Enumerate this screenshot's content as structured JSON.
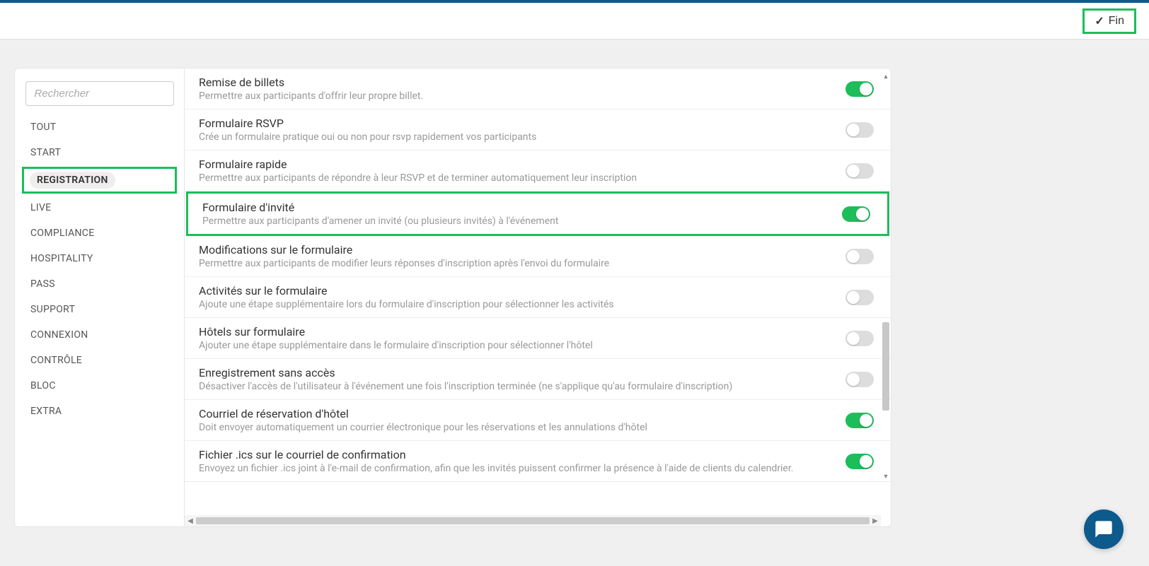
{
  "header": {
    "fin_label": "Fin"
  },
  "sidebar": {
    "search_placeholder": "Rechercher",
    "items": [
      {
        "label": "TOUT"
      },
      {
        "label": "START"
      },
      {
        "label": "REGISTRATION"
      },
      {
        "label": "LIVE"
      },
      {
        "label": "COMPLIANCE"
      },
      {
        "label": "HOSPITALITY"
      },
      {
        "label": "PASS"
      },
      {
        "label": "SUPPORT"
      },
      {
        "label": "CONNEXION"
      },
      {
        "label": "CONTRÔLE"
      },
      {
        "label": "BLOC"
      },
      {
        "label": "EXTRA"
      }
    ]
  },
  "settings": [
    {
      "title": "Remise de billets",
      "desc": "Permettre aux participants d'offrir leur propre billet.",
      "on": true,
      "highlighted": false
    },
    {
      "title": "Formulaire RSVP",
      "desc": "Crée un formulaire pratique oui ou non pour rsvp rapidement vos participants",
      "on": false,
      "highlighted": false
    },
    {
      "title": "Formulaire rapide",
      "desc": "Permettre aux participants de répondre à leur RSVP et de terminer automatiquement leur inscription",
      "on": false,
      "highlighted": false
    },
    {
      "title": "Formulaire d'invité",
      "desc": "Permettre aux participants d'amener un invité (ou plusieurs invités) à l'événement",
      "on": true,
      "highlighted": true
    },
    {
      "title": "Modifications sur le formulaire",
      "desc": "Permettre aux participants de modifier leurs réponses d'inscription après l'envoi du formulaire",
      "on": false,
      "highlighted": false
    },
    {
      "title": "Activités sur le formulaire",
      "desc": "Ajoute une étape supplémentaire lors du formulaire d'inscription pour sélectionner les activités",
      "on": false,
      "highlighted": false
    },
    {
      "title": "Hôtels sur formulaire",
      "desc": "Ajouter une étape supplémentaire dans le formulaire d'inscription pour sélectionner l'hôtel",
      "on": false,
      "highlighted": false
    },
    {
      "title": "Enregistrement sans accès",
      "desc": "Désactiver l'accès de l'utilisateur à l'événement une fois l'inscription terminée (ne s'applique qu'au formulaire d'inscription)",
      "on": false,
      "highlighted": false
    },
    {
      "title": "Courriel de réservation d'hôtel",
      "desc": "Doit envoyer automatiquement un courrier électronique pour les réservations et les annulations d'hôtel",
      "on": true,
      "highlighted": false
    },
    {
      "title": "Fichier .ics sur le courriel de confirmation",
      "desc": "Envoyez un fichier .ics joint à l'e-mail de confirmation, afin que les invités puissent confirmer la présence à l'aide de clients du calendrier.",
      "on": true,
      "highlighted": false
    }
  ]
}
